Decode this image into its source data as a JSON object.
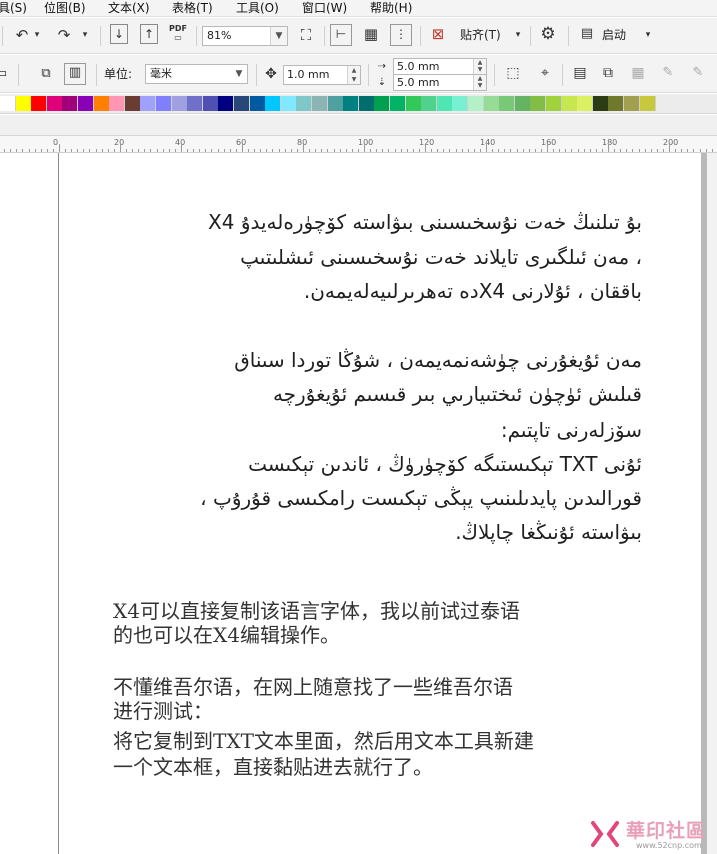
{
  "menubar": {
    "items": [
      {
        "label": "具(S)"
      },
      {
        "label": "位图(B)"
      },
      {
        "label": "文本(X)"
      },
      {
        "label": "表格(T)"
      },
      {
        "label": "工具(O)"
      },
      {
        "label": "窗口(W)"
      },
      {
        "label": "帮助(H)"
      }
    ]
  },
  "toolbar": {
    "zoom_value": "81%",
    "pdf_label": "PDF",
    "snap_label": "贴齐(T)",
    "launch_label": "启动"
  },
  "propbar": {
    "unit_label": "单位:",
    "unit_value": "毫米",
    "nudge_value": "1.0 mm",
    "dup_x_value": "5.0 mm",
    "dup_y_value": "5.0 mm"
  },
  "palette": {
    "colors": [
      "#ffffff",
      "#ffff00",
      "#ff0000",
      "#e0007a",
      "#a0007a",
      "#8a00b4",
      "#ff8000",
      "#ff96b4",
      "#6a3c32",
      "#a0a0ff",
      "#8080ff",
      "#a0a0e0",
      "#7070c8",
      "#5050b4",
      "#000080",
      "#284678",
      "#005aa0",
      "#00c8ff",
      "#80e8ff",
      "#80c8c8",
      "#8cb4b4",
      "#50a0a0",
      "#008080",
      "#006e6e",
      "#00a050",
      "#00b464",
      "#32c85a",
      "#50d28c",
      "#50e6b4",
      "#78f0d2",
      "#b4f0c8",
      "#96dc96",
      "#78c878",
      "#64b464",
      "#82be46",
      "#a0d23c",
      "#c8e650",
      "#dcf064",
      "#2c3c14",
      "#70782c",
      "#a0a050",
      "#c8c83c"
    ]
  },
  "ruler": {
    "ticks": [
      "0",
      "20",
      "40",
      "60",
      "80",
      "100",
      "120",
      "140",
      "160",
      "180",
      "200"
    ]
  },
  "document": {
    "uyghur_lines": [
      "بۇ تىلنىڭ خەت نۇسخىسىنى بىۋاستە كۆچۈرەلەيدۇ X4",
      "، مەن ئىلگىرى تايلاند خەت نۇسخىسىنى ئىشلىتىپ",
      "باققان ، ئۇلارنى X4دە تەھرىرلىيەلەيمەن.",
      "مەن ئۇيغۇرنى چۈشەنمەيمەن ، شۇڭا توردا سىناق",
      "قىلىش ئۈچۈن ئىختىيارىي بىر قىسىم ئۇيغۇرچە",
      "سۆزلەرنى تاپتىم:",
      "ئۇنى TXT تېكىستىگە كۆچۈرۈڭ ، ئاندىن تېكىست",
      "قورالىدىن پايدىلىنىپ يېڭى تېكىست رامكىسى قۇرۇپ ،",
      "بىۋاستە ئۇنىڭغا چاپلاڭ."
    ],
    "chinese_lines": [
      "X4可以直接复制该语言字体，我以前试过泰语",
      "的也可以在X4编辑操作。",
      "不懂维吾尔语，在网上随意找了一些维吾尔语",
      "进行测试：",
      "将它复制到TXT文本里面，然后用文本工具新建",
      "一个文本框，直接黏贴进去就行了。"
    ]
  },
  "watermark": {
    "site_name": "華印社區",
    "site_url": "www.52cnp.com"
  }
}
